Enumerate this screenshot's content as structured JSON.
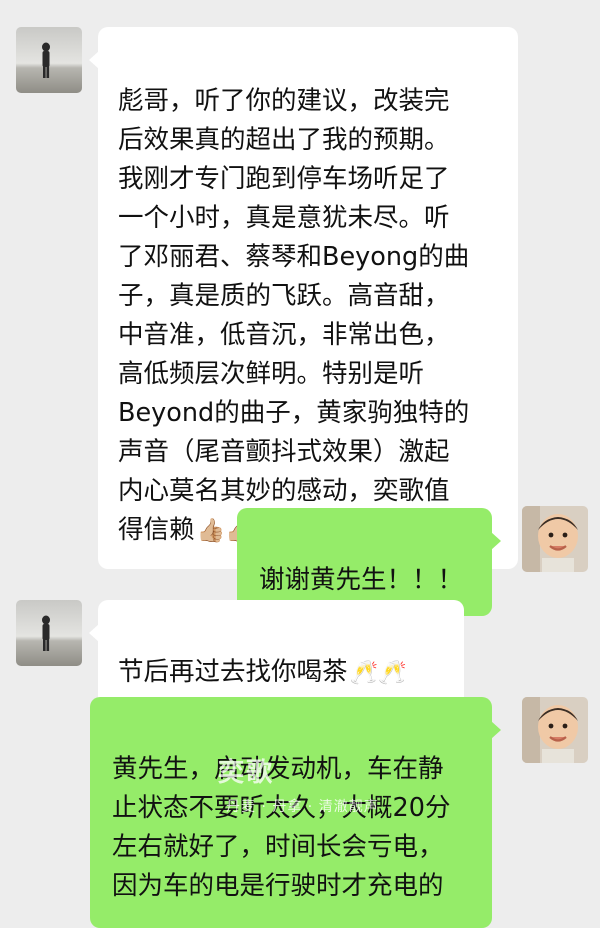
{
  "messages": [
    {
      "side": "received",
      "text": "彪哥，听了你的建议，改装完\n后效果真的超出了我的预期。\n我刚才专门跑到停车场听足了\n一个小时，真是意犹未尽。听\n了邓丽君、蔡琴和Beyong的曲\n子，真是质的飞跃。高音甜，\n中音准，低音沉，非常出色，\n高低频层次鲜明。特别是听\nBeyond的曲子，黄家驹独特的\n声音（尾音颤抖式效果）激起\n内心莫名其妙的感动，奕歌值\n得信赖",
      "emoji": "👍🏼👍🏼"
    },
    {
      "side": "sent",
      "text": "谢谢黄先生！！！"
    },
    {
      "side": "received",
      "text": "节后再过去找你喝茶",
      "emoji": "🥂🥂"
    },
    {
      "side": "sent",
      "text": "黄先生，启动发动机，车在静\n止状态不要听太久，大概20分\n左右就好了，时间长会亏电，\n因为车的电是行驶时才充电的"
    }
  ],
  "watermark": {
    "main": "奕歌",
    "sub": "丹麦 · 丹拿 · 清澈靓声"
  },
  "colors": {
    "background": "#ededed",
    "received_bubble": "#ffffff",
    "sent_bubble": "#95ec69"
  }
}
